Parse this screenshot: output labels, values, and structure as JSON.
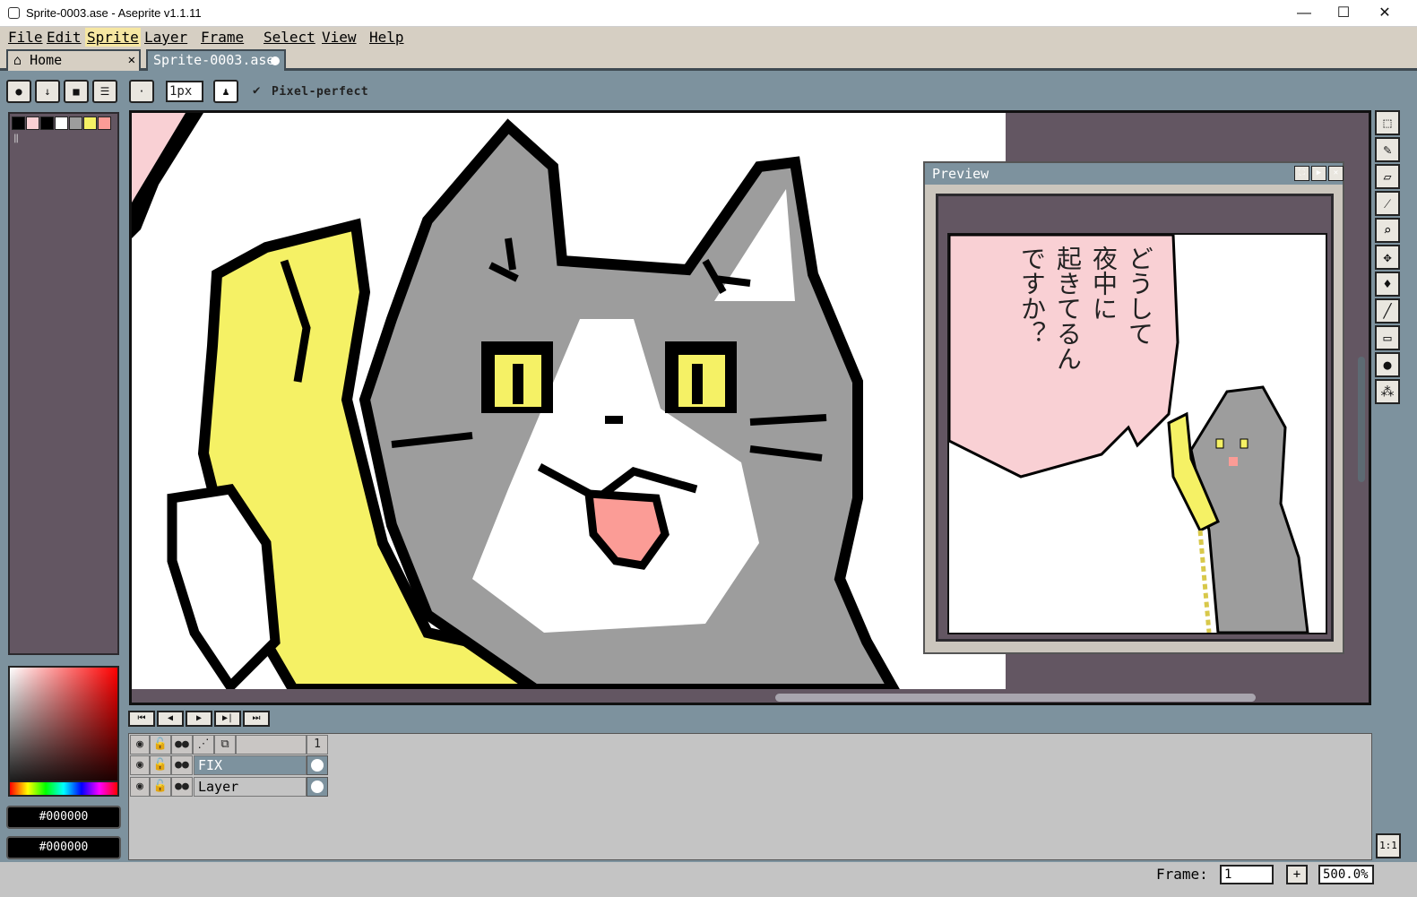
{
  "window": {
    "title": "Sprite-0003.ase - Aseprite v1.1.11",
    "minimize_glyph": "—",
    "maximize_glyph": "☐",
    "close_glyph": "✕"
  },
  "menu": [
    "File",
    "Edit",
    "Sprite",
    "Layer",
    "Frame",
    "Select",
    "View",
    "Help"
  ],
  "tabs": {
    "home": "Home",
    "home_close": "✕",
    "document": "Sprite-0003.ase"
  },
  "toolbar": {
    "brush_size": "1px",
    "pixel_perfect_check": "✔",
    "pixel_perfect_label": "Pixel-perfect"
  },
  "palette": {
    "swatches": [
      "#000000",
      "#f9d0d4",
      "#000000",
      "#ffffff",
      "#9d9d9d",
      "#f5f165",
      "#fb9c96"
    ]
  },
  "colors": {
    "foreground_hex": "#000000",
    "background_hex": "#000000",
    "canvas_bg": "#ffffff",
    "workspace": "#635662",
    "yellow": "#f5f165",
    "gray": "#9d9d9d",
    "pink": "#f9d0d4",
    "tongue": "#fb9c96"
  },
  "preview": {
    "title": "Preview",
    "speech_text": [
      "どうして",
      "夜中に",
      "起きてるん",
      "ですか？"
    ]
  },
  "tools": [
    "marquee-icon",
    "pencil-icon",
    "eraser-icon",
    "eyedropper-icon",
    "zoom-icon",
    "move-icon",
    "fill-icon",
    "line-icon",
    "rectangle-icon",
    "blur-icon",
    "spray-icon"
  ],
  "timeline": {
    "frame_header": "1",
    "layers": [
      {
        "name": "FIX",
        "selected": true
      },
      {
        "name": "Layer",
        "selected": false
      }
    ]
  },
  "status": {
    "frame_label": "Frame:",
    "frame_value": "1",
    "plus": "+",
    "zoom": "500.0%",
    "ratio": "1:1"
  }
}
